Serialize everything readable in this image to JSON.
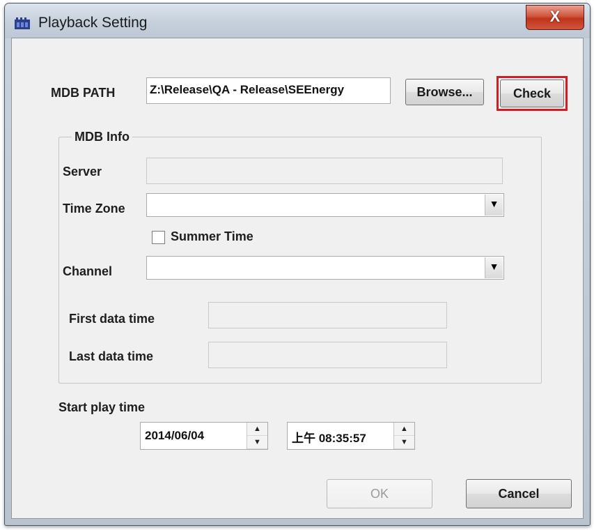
{
  "window": {
    "title": "Playback Setting",
    "close_glyph": "X"
  },
  "mdb_path": {
    "label": "MDB PATH",
    "value": "Z:\\Release\\QA - Release\\SEEnergy",
    "browse_label": "Browse...",
    "check_label": "Check",
    "highlight_color": "#d01c24"
  },
  "mdb_info": {
    "group_label": "MDB Info",
    "server_label": "Server",
    "server_value": "",
    "timezone_label": "Time Zone",
    "timezone_value": "",
    "summer_time_label": "Summer Time",
    "summer_time_checked": false,
    "channel_label": "Channel",
    "channel_value": "",
    "first_data_time_label": "First data time",
    "first_data_time_value": "",
    "last_data_time_label": "Last data time",
    "last_data_time_value": ""
  },
  "start_play": {
    "label": "Start play time",
    "date_value": "2014/06/04",
    "time_value": "上午 08:35:57"
  },
  "footer": {
    "ok_label": "OK",
    "ok_enabled": false,
    "cancel_label": "Cancel"
  },
  "icons": {
    "app": "film-strip-icon",
    "dropdown": "chevron-down-icon",
    "spin_up": "arrow-up-icon",
    "spin_down": "arrow-down-icon"
  }
}
